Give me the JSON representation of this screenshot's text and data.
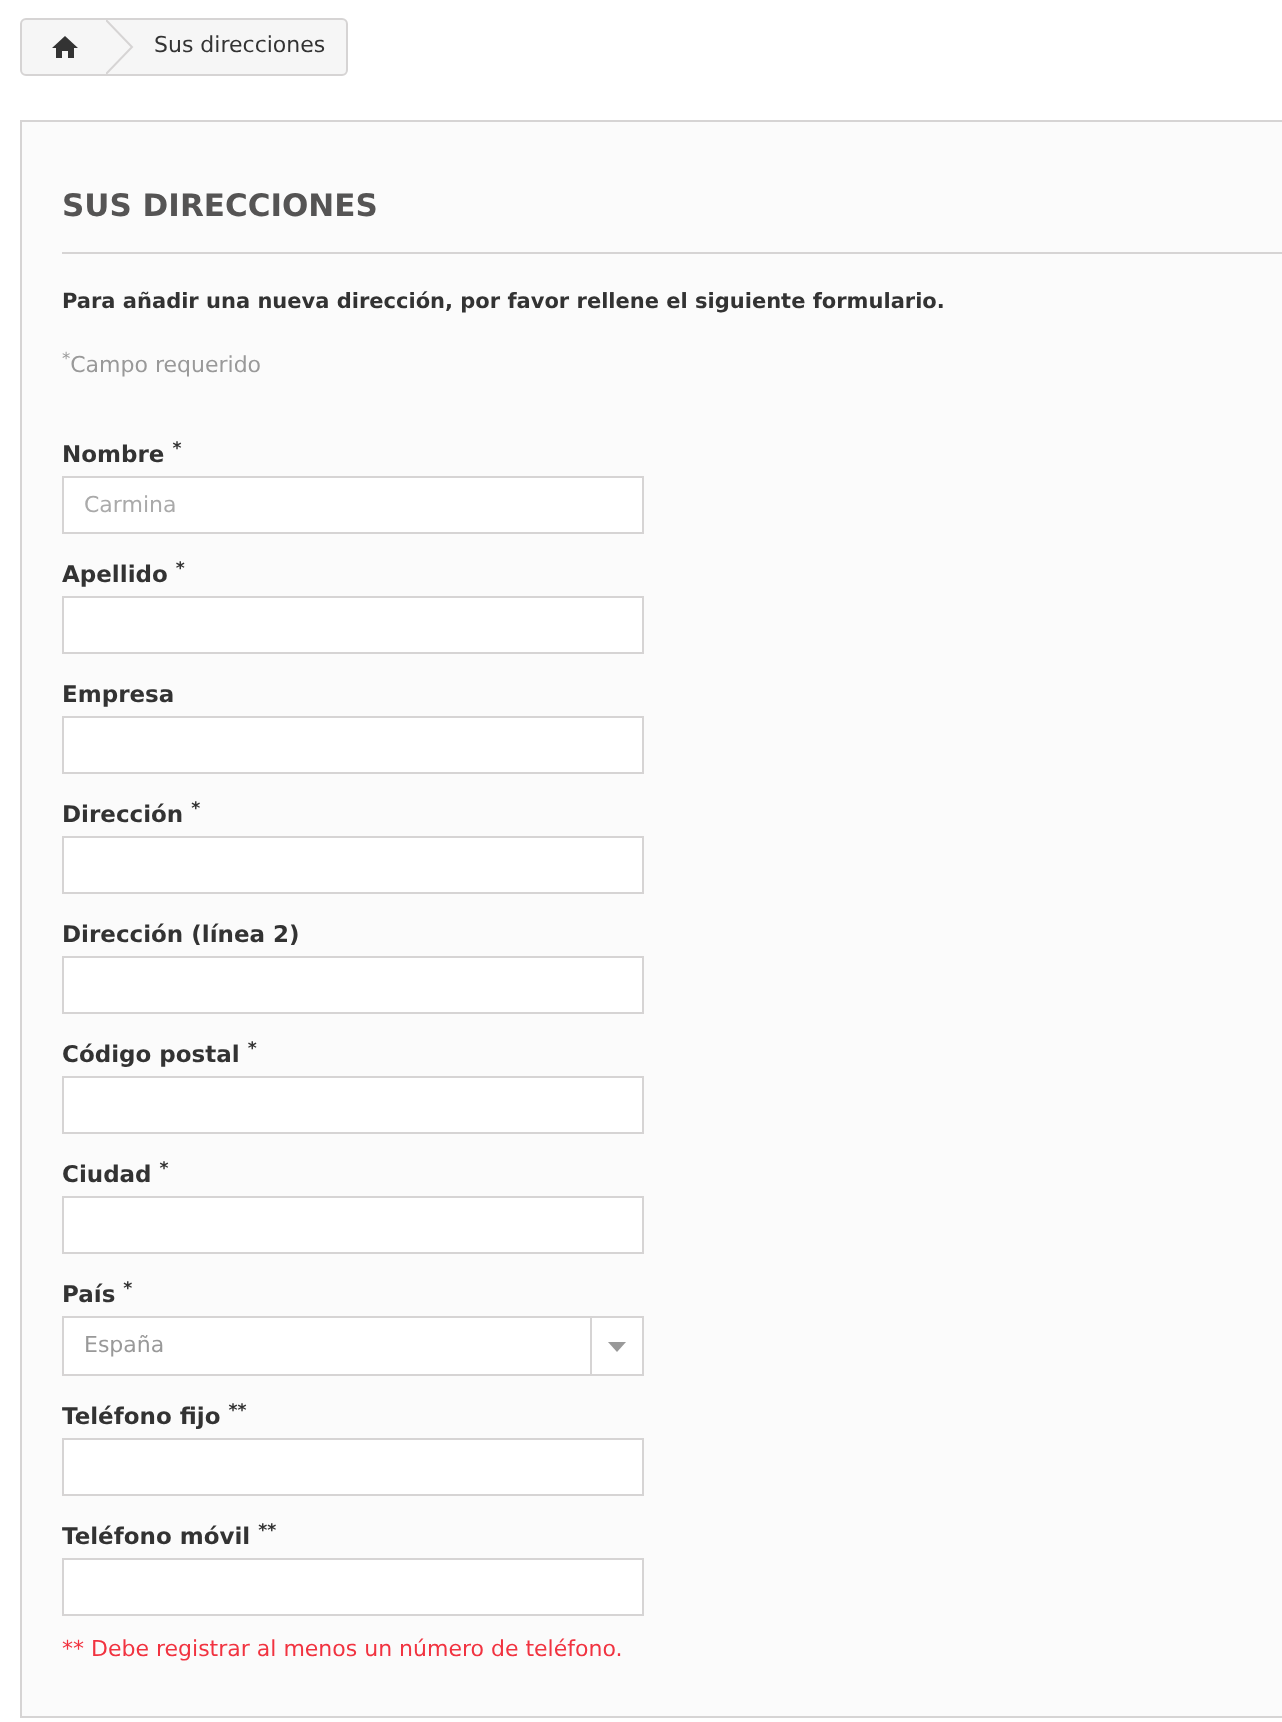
{
  "breadcrumb": {
    "current": "Sus direcciones"
  },
  "title": "SUS DIRECCIONES",
  "intro": "Para añadir una nueva dirección, por favor rellene el siguiente formulario.",
  "required_note": "$^{*}$Campo requerido",
  "fields": [
    {
      "kind": "text",
      "label": "Nombre $^{*}$",
      "placeholder": "Carmina"
    },
    {
      "kind": "text",
      "label": "Apellido $^{*}$"
    },
    {
      "kind": "text",
      "label": "Empresa"
    },
    {
      "kind": "text",
      "label": "Dirección $^{*}$"
    },
    {
      "kind": "text",
      "label": "Dirección (línea 2)"
    },
    {
      "kind": "text",
      "label": "Código postal $^{*}$"
    },
    {
      "kind": "text",
      "label": "Ciudad $^{*}$"
    },
    {
      "kind": "select",
      "label": "País $^{*}$",
      "value": "España"
    },
    {
      "kind": "text",
      "label": "Teléfono fijo $^{**}$"
    },
    {
      "kind": "text",
      "label": "Teléfono móvil $^{**}$"
    }
  ],
  "phone_note": "** Debe registrar al menos un número de teléfono."
}
